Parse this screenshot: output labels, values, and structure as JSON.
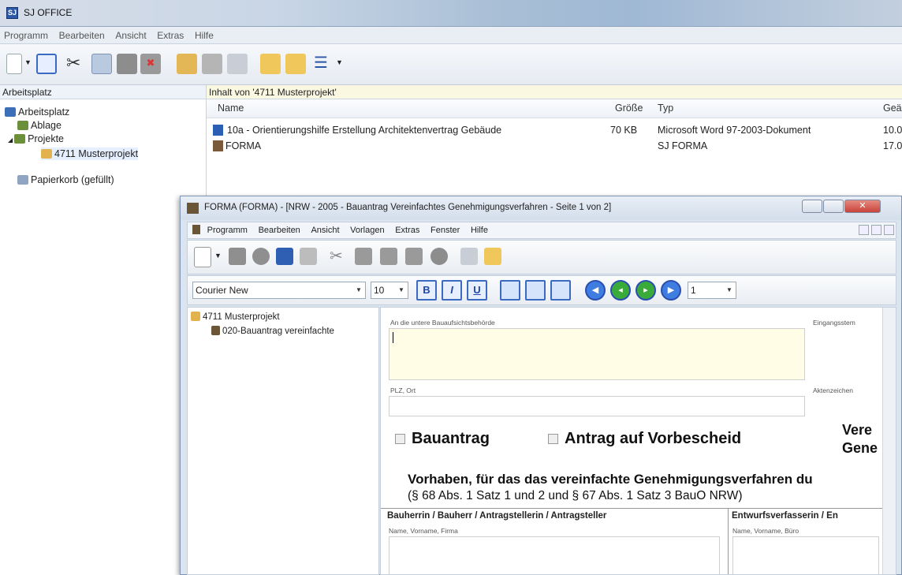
{
  "app": {
    "title": "SJ OFFICE"
  },
  "menu": [
    "Programm",
    "Bearbeiten",
    "Ansicht",
    "Extras",
    "Hilfe"
  ],
  "left_pane": {
    "header": "Arbeitsplatz",
    "tree": [
      {
        "label": "Arbeitsplatz"
      },
      {
        "label": "Ablage"
      },
      {
        "label": "Projekte"
      },
      {
        "label": "4711 Musterprojekt"
      },
      {
        "label": "Papierkorb (gefüllt)"
      }
    ]
  },
  "right_pane": {
    "header": "Inhalt von '4711 Musterprojekt'",
    "columns": [
      "Name",
      "Größe",
      "Typ",
      "Geä"
    ],
    "files": [
      {
        "name": "10a - Orientierungshilfe Erstellung Architektenvertrag Gebäude",
        "size": "70 KB",
        "type": "Microsoft Word 97-2003-Dokument",
        "date": "10.0"
      },
      {
        "name": "FORMA",
        "size": "",
        "type": "SJ FORMA",
        "date": "17.0"
      }
    ]
  },
  "forma": {
    "title": "FORMA (FORMA) - [NRW - 2005 - Bauantrag Vereinfachtes Genehmigungsverfahren - Seite 1 von 2]",
    "menu": [
      "Programm",
      "Bearbeiten",
      "Ansicht",
      "Vorlagen",
      "Extras",
      "Fenster",
      "Hilfe"
    ],
    "font_family": "Courier New",
    "font_size": "10",
    "page_selector": "1",
    "tree": [
      "4711 Musterprojekt",
      "020-Bauantrag vereinfachte"
    ],
    "doc": {
      "label_behoerde": "An die untere Bauaufsichtsbehörde",
      "label_eingang": "Eingangsstem",
      "label_plz": "PLZ, Ort",
      "label_akten": "Aktenzeichen",
      "check_bauantrag": "Bauantrag",
      "check_vorbescheid": "Antrag auf Vorbescheid",
      "right_title_1": "Vere",
      "right_title_2": "Gene",
      "vorhaben": "Vorhaben, für das das vereinfachte Genehmigungsverfahren du",
      "paragraph": "(§ 68 Abs. 1 Satz 1 und 2 und § 67 Abs. 1 Satz 3 BauO NRW)",
      "col_bauherr": "Bauherrin / Bauherr / Antragstellerin / Antragsteller",
      "col_entwurf": "Entwurfsverfasserin / En",
      "lbl_name_firma": "Name, Vorname, Firma",
      "lbl_name_buero": "Name, Vorname, Büro"
    }
  },
  "colors": {
    "accent": "#3a6bc0",
    "yellow_field": "#fffde6",
    "close": "#c9433a"
  }
}
